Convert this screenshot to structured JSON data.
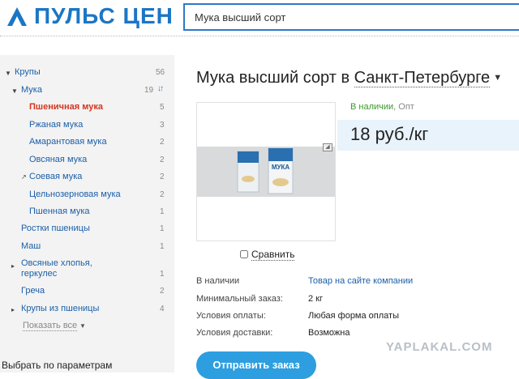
{
  "header": {
    "logo_text": "ПУЛЬС ЦЕН",
    "search_value": "Мука высший сорт"
  },
  "sidebar": {
    "categories": [
      {
        "label": "Крупы",
        "count": "56"
      },
      {
        "label": "Мука",
        "count": "19"
      },
      {
        "label": "Пшеничная мука",
        "count": "5"
      },
      {
        "label": "Ржаная мука",
        "count": "3"
      },
      {
        "label": "Амарантовая мука",
        "count": "2"
      },
      {
        "label": "Овсяная мука",
        "count": "2"
      },
      {
        "label": "Соевая мука",
        "count": "2"
      },
      {
        "label": "Цельнозерновая мука",
        "count": "2"
      },
      {
        "label": "Пшенная мука",
        "count": "1"
      },
      {
        "label": "Ростки пшеницы",
        "count": "1"
      },
      {
        "label": "Маш",
        "count": "1"
      },
      {
        "label": "Овсяные хлопья,",
        "label2": "геркулес",
        "count": "1"
      },
      {
        "label": "Греча",
        "count": "2"
      },
      {
        "label": "Крупы из пшеницы",
        "count": "4"
      }
    ],
    "show_all": "Показать все",
    "params_title": "Выбрать по параметрам"
  },
  "main": {
    "title": "Мука высший сорт в",
    "city": "Санкт-Петербурге",
    "availability": "В наличии",
    "availability_suffix": ", Опт",
    "price": "18 руб./кг",
    "compare_label": "Сравнить",
    "details": [
      {
        "label": "В наличии",
        "value": "Товар на сайте компании"
      },
      {
        "label": "Минимальный заказ:",
        "value": "2 кг"
      },
      {
        "label": "Условия оплаты:",
        "value": "Любая форма оплаты"
      },
      {
        "label": "Условия доставки:",
        "value": "Возможна"
      }
    ],
    "order_button": "Отправить заказ",
    "package_text": "МУКА"
  },
  "watermark": "YAPLAKAL.COM",
  "colors": {
    "brand": "#1b76c5",
    "active_category": "#d5351f",
    "link": "#1b5fa8",
    "in_stock": "#3a9a2a",
    "button": "#2d9ee0"
  }
}
